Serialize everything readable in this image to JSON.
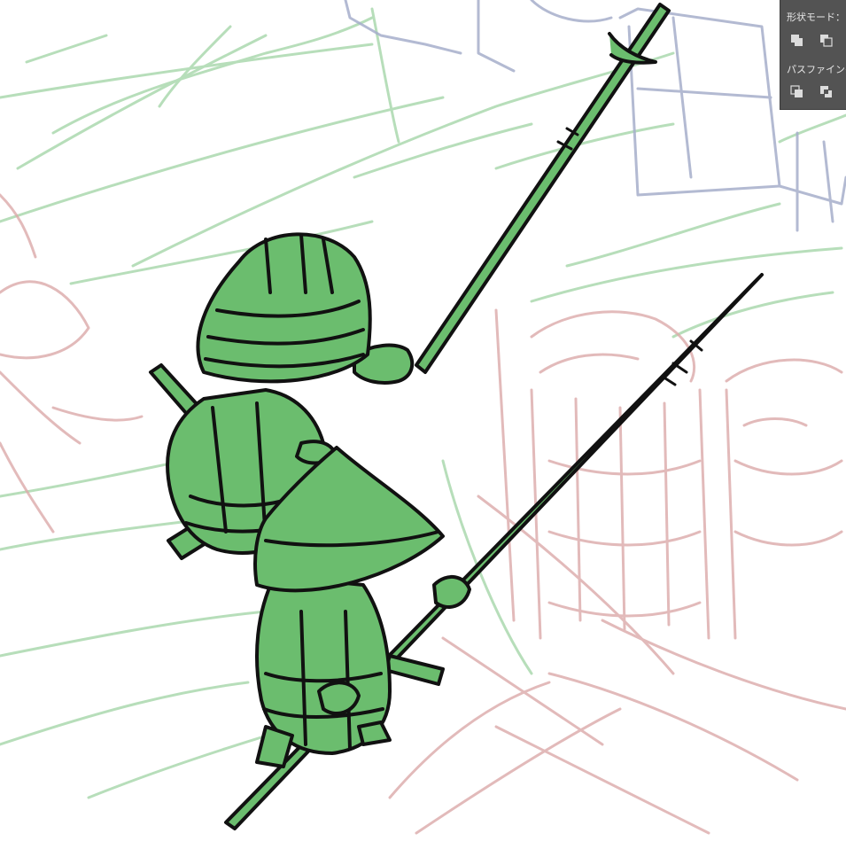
{
  "pathfinder_panel": {
    "shape_modes_label": "形状モード：",
    "pathfinders_label": "パスファインダー："
  },
  "icons": {
    "shape_modes": [
      "unite-icon",
      "minus-front-icon"
    ],
    "pathfinders": [
      "divide-icon",
      "trim-icon"
    ]
  },
  "colors": {
    "panel_bg": "#535353",
    "character_fill": "#6bbd6e",
    "outline": "#111111",
    "sketch_green": "#7fc584",
    "sketch_red": "#d9a3a3",
    "sketch_blue": "#9aa4c6"
  }
}
